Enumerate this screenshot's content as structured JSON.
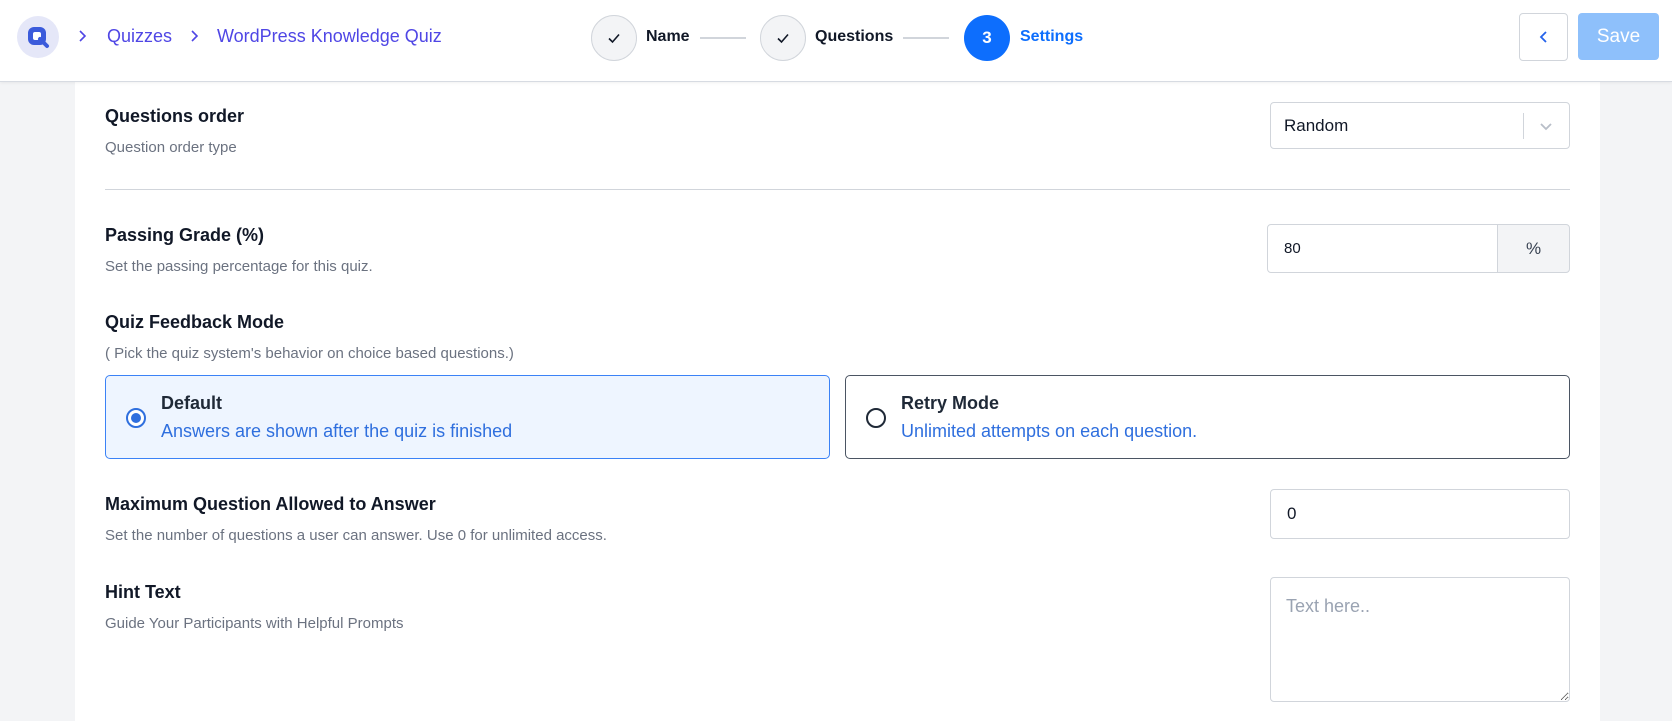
{
  "header": {
    "breadcrumbs": [
      "Quizzes",
      "WordPress Knowledge Quiz"
    ],
    "steps": [
      {
        "label": "Name",
        "state": "done"
      },
      {
        "label": "Questions",
        "state": "done"
      },
      {
        "number": "3",
        "label": "Settings",
        "state": "active"
      }
    ],
    "save_label": "Save"
  },
  "settings": {
    "questions_order": {
      "title": "Questions order",
      "description": "Question order type",
      "value": "Random"
    },
    "passing_grade": {
      "title": "Passing Grade (%)",
      "description": "Set the passing percentage for this quiz.",
      "value": "80",
      "unit": "%"
    },
    "feedback_mode": {
      "title": "Quiz Feedback Mode",
      "description": "( Pick the quiz system's behavior on choice based questions.)",
      "selected": "default",
      "options": [
        {
          "title": "Default",
          "description": "Answers are shown after the quiz is finished"
        },
        {
          "title": "Retry Mode",
          "description": "Unlimited attempts on each question."
        }
      ]
    },
    "max_questions": {
      "title": "Maximum Question Allowed to Answer",
      "description": "Set the number of questions a user can answer. Use 0 for unlimited access.",
      "value": "0"
    },
    "hint_text": {
      "title": "Hint Text",
      "description": "Guide Your Participants with Helpful Prompts",
      "placeholder": "Text here.."
    }
  },
  "colors": {
    "primary": "#0d6efd",
    "breadcrumb": "#4f46e5",
    "save_disabled": "#8ec0fb",
    "selected_card_bg": "#eef5ff"
  },
  "icons": [
    "logo-icon",
    "chevron-right-icon",
    "check-icon",
    "chevron-left-icon",
    "chevron-down-icon",
    "resize-handle-icon"
  ]
}
